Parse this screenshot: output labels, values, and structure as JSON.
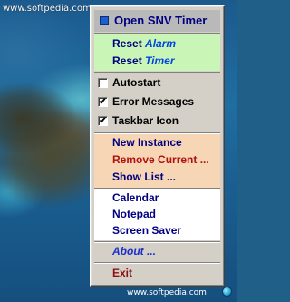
{
  "watermark": {
    "top": "www.softpedia.com",
    "bottom": "www.softpedia.com"
  },
  "menu": {
    "header": {
      "label": "Open SNV Timer"
    },
    "reset": [
      {
        "verb": "Reset",
        "target": "Alarm"
      },
      {
        "verb": "Reset",
        "target": "Timer"
      }
    ],
    "options": [
      {
        "label": "Autostart",
        "checked": false,
        "mark": ""
      },
      {
        "label": "Error Messages",
        "checked": true,
        "mark": "✔"
      },
      {
        "label": "Taskbar Icon",
        "checked": true,
        "mark": "✔"
      }
    ],
    "instances": [
      {
        "label": "New Instance"
      },
      {
        "label": "Remove Current ..."
      },
      {
        "label": "Show List ..."
      }
    ],
    "tools": [
      {
        "label": "Calendar"
      },
      {
        "label": "Notepad"
      },
      {
        "label": "Screen Saver"
      }
    ],
    "about": {
      "label": "About ..."
    },
    "exit": {
      "label": "Exit"
    }
  },
  "colors": {
    "header_bg": "#b9b9b9",
    "reset_bg": "#c9f5b6",
    "instances_bg": "#f6d6b4",
    "tools_bg": "#ffffff",
    "menu_bg": "#d4d0c8",
    "accent_blue": "#000080",
    "accent_red": "#b01010"
  }
}
